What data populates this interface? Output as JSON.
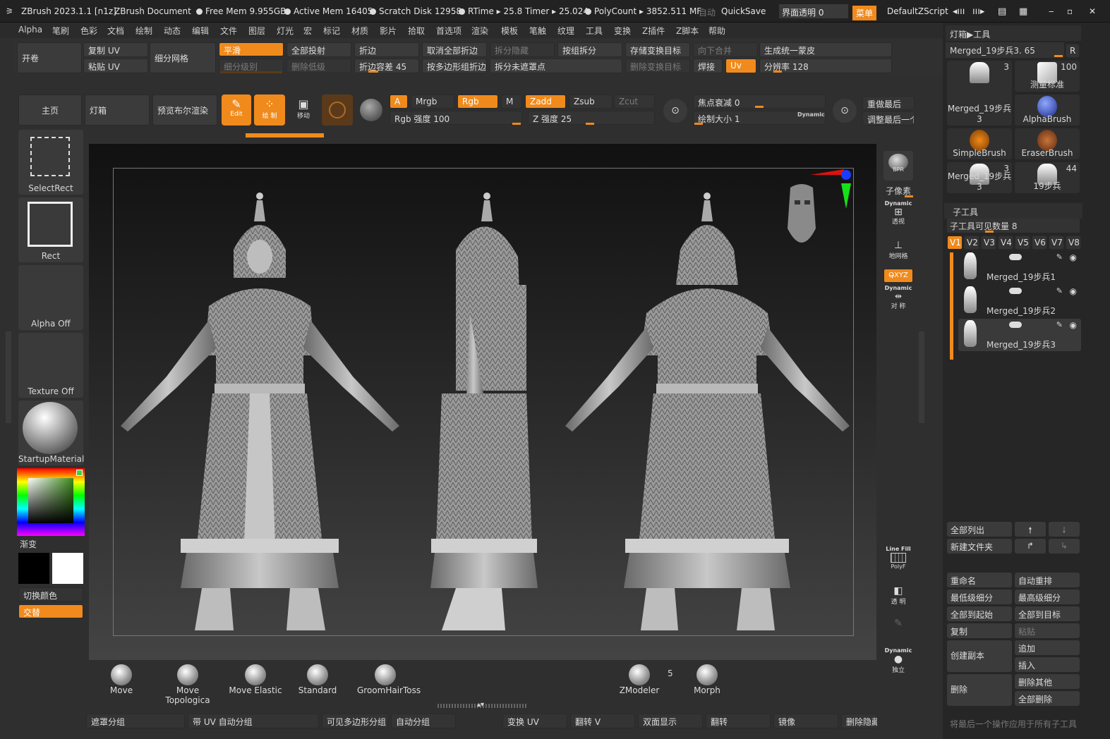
{
  "title_bar": {
    "app_name": "ZBrush 2023.1.1 [n1z]",
    "document": "ZBrush Document",
    "free_mem": "Free Mem 9.955GB",
    "active_mem": "Active Mem 16405",
    "scratch_disk": "Scratch Disk 12958",
    "rtime": "RTime ▸ 25.8 Timer ▸ 25.024",
    "polycount": "PolyCount ▸ 3852.511 MF",
    "auto": "自动",
    "quicksave": "QuickSave",
    "ui_transparency": "界面透明 0",
    "menu_button": "菜单",
    "script": "DefaultZScript"
  },
  "menu_items": [
    "Alpha",
    "笔刷",
    "色彩",
    "文档",
    "绘制",
    "动态",
    "编辑",
    "文件",
    "图层",
    "灯光",
    "宏",
    "标记",
    "材质",
    "影片",
    "拾取",
    "首选项",
    "渲染",
    "模板",
    "笔触",
    "纹理",
    "工具",
    "变换",
    "Z插件",
    "Z脚本",
    "帮助"
  ],
  "toolbar1": {
    "open": "开卷",
    "copy_uv": "复制 UV",
    "paste_uv": "粘贴 UV",
    "subdivide": "细分网格",
    "smooth": "平滑",
    "subdiv_level": "细分级别",
    "project_all": "全部投射",
    "delete_lower": "删除低级",
    "crease": "折边",
    "crease_tol": "折边容差 45",
    "uncrease_all": "取消全部折边",
    "crease_pg": "按多边形组折边",
    "split_hidden": "拆分隐藏",
    "split_unmasked": "拆分未遮罩点",
    "group_split": "按组拆分",
    "store_morph": "存储变换目标",
    "delete_morph": "删除变换目标",
    "merge_down": "向下合并",
    "weld": "焊接",
    "uv": "Uv",
    "unified_skin": "生成统一蒙皮",
    "resolution": "分辨率 128"
  },
  "toolbar2": {
    "home": "主页",
    "lightbox": "灯箱",
    "bpr_preview": "预览布尔渲染",
    "edit": "Edit",
    "draw": "绘 制",
    "move": "移动",
    "a": "A",
    "mrgb": "Mrgb",
    "rgb": "Rgb",
    "m": "M",
    "zadd": "Zadd",
    "zsub": "Zsub",
    "zcut": "Zcut",
    "rgb_intensity": "Rgb 强度 100",
    "z_intensity": "Z 强度 25",
    "focal_shift": "焦点衰减 0",
    "draw_size": "绘制大小 1",
    "dynamic": "Dynamic",
    "redo_last": "重做最后",
    "adjust_last": "调整最后一个"
  },
  "left_panel": {
    "select_rect": "SelectRect",
    "rect": "Rect",
    "alpha_off": "Alpha Off",
    "texture_off": "Texture Off",
    "material": "StartupMaterial",
    "gradient": "渐变",
    "switch_color": "切换颜色",
    "alternate": "交替"
  },
  "right_shelf": {
    "bpr": "BPR",
    "subpixel": "子像素",
    "dynamic": "Dynamic",
    "persp": "透视",
    "floor": "地网格",
    "xyz": "Q̶XYZ",
    "sym": "对 称",
    "linefill": "Line Fill",
    "polyf": "PolyF",
    "transp": "透 明",
    "solo": "独立"
  },
  "tool_panel": {
    "header": "灯箱▶工具",
    "current_tool": "Merged_19步兵3. 65",
    "r_button": "R",
    "thumbs": [
      {
        "label": "Merged_19步兵3",
        "count": "3"
      },
      {
        "label": "测量标准",
        "count": "100"
      },
      {
        "label": "Merged_19步兵3",
        "count": ""
      },
      {
        "label": "AlphaBrush",
        "count": ""
      },
      {
        "label": "SimpleBrush",
        "count": ""
      },
      {
        "label": "EraserBrush",
        "count": ""
      },
      {
        "label": "Merged_19步兵3",
        "count": "3"
      },
      {
        "label": "19步兵",
        "count": "44"
      }
    ],
    "subtool_header": "子工具",
    "visible_count": "子工具可见数量 8",
    "version_tabs": [
      "V1",
      "V2",
      "V3",
      "V4",
      "V5",
      "V6",
      "V7",
      "V8"
    ],
    "subtools": [
      "Merged_19步兵1",
      "Merged_19步兵2",
      "Merged_19步兵3"
    ],
    "list_all": "全部列出",
    "new_folder": "新建文件夹",
    "rename": "重命名",
    "auto_reorder": "自动重排",
    "lowest_subdiv": "最低级细分",
    "highest_subdiv": "最高级细分",
    "all_to_start": "全部到起始",
    "all_to_target": "全部到目标",
    "duplicate": "复制",
    "paste": "粘贴",
    "create_copy": "创建副本",
    "append": "追加",
    "insert": "插入",
    "delete": "删除",
    "delete_other": "删除其他",
    "delete_all": "全部删除",
    "apply_last": "将最后一个操作应用于所有子工具"
  },
  "bottom_brushes": [
    {
      "label": "Move"
    },
    {
      "label": "Move Topologica"
    },
    {
      "label": "Move Elastic"
    },
    {
      "label": "Standard"
    },
    {
      "label": "GroomHairToss"
    },
    {
      "label": "ZModeler"
    },
    {
      "label": "Morph"
    }
  ],
  "zmodeler_count": "5",
  "bottom_bar": [
    "遮罩分组",
    "带 UV 自动分组",
    "可见多边形分组",
    "自动分组",
    "变换 UV",
    "翻转 V",
    "双面显示",
    "翻转",
    "镜像",
    "删除隐藏"
  ],
  "colors": {
    "accent": "#f08a1c",
    "bg": "#2f2f2f"
  }
}
